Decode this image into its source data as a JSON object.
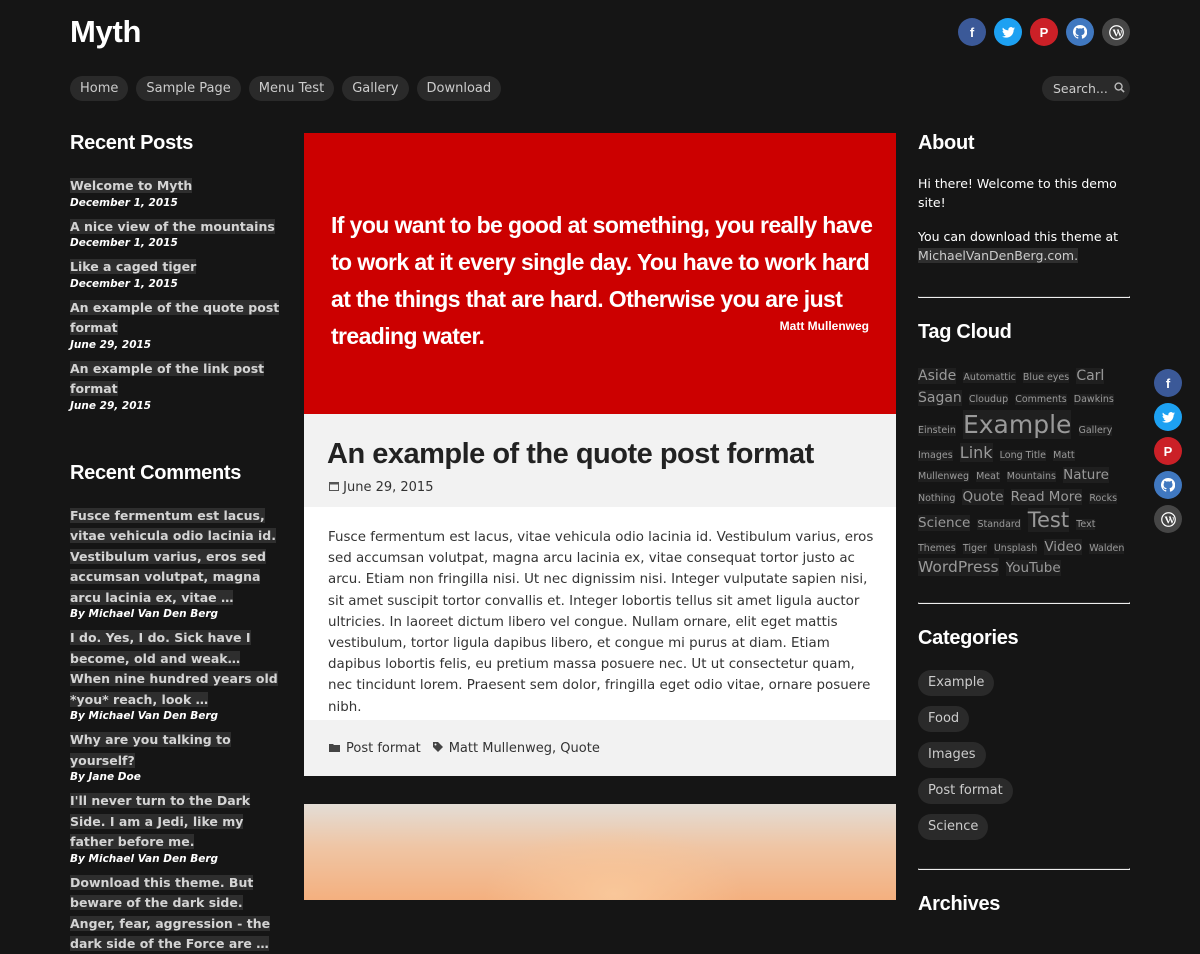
{
  "site": {
    "title": "Myth"
  },
  "social": [
    "facebook-icon",
    "twitter-icon",
    "pinterest-icon",
    "github-icon",
    "wordpress-icon"
  ],
  "nav": {
    "items": [
      "Home",
      "Sample Page",
      "Menu Test",
      "Gallery",
      "Download"
    ]
  },
  "search": {
    "placeholder": "Search..."
  },
  "recent_posts": {
    "title": "Recent Posts",
    "items": [
      {
        "title": "Welcome to Myth",
        "date": "December 1, 2015"
      },
      {
        "title": "A nice view of the mountains",
        "date": "December 1, 2015"
      },
      {
        "title": "Like a caged tiger",
        "date": "December 1, 2015"
      },
      {
        "title": "An example of the quote post format",
        "date": "June 29, 2015"
      },
      {
        "title": "An example of the link post format",
        "date": "June 29, 2015"
      }
    ]
  },
  "recent_comments": {
    "title": "Recent Comments",
    "items": [
      {
        "text": "Fusce fermentum est lacus, vitae vehicula odio lacinia id. Vestibulum varius, eros sed accumsan volutpat, magna arcu lacinia ex, vitae …",
        "by": "By",
        "author": "Michael Van Den Berg"
      },
      {
        "text": "I do. Yes, I do. Sick have I become, old and weak… When nine hundred years old *you* reach, look …",
        "by": "By",
        "author": "Michael Van Den Berg"
      },
      {
        "text": "Why are you talking to yourself?",
        "by": "By",
        "author": "Jane Doe"
      },
      {
        "text": "I'll never turn to the Dark Side. I am a Jedi, like my father before me.",
        "by": "By",
        "author": "Michael Van Den Berg"
      },
      {
        "text": "Download this theme. But beware of the dark side. Anger, fear, aggression - the dark side of the Force are …",
        "by": "",
        "author": ""
      }
    ]
  },
  "quote": {
    "text": "If you want to be good at something, you really have to work at it every single day. You have to work hard at the things that are hard. Otherwise you are just treading water.",
    "author": "Matt Mullenweg"
  },
  "post": {
    "title": "An example of the quote post format",
    "date": "June 29, 2015",
    "body": "Fusce fermentum est lacus, vitae vehicula odio lacinia id. Vestibulum varius, eros sed accumsan volutpat, magna arcu lacinia ex, vitae consequat tortor justo ac arcu. Etiam non fringilla nisi. Ut nec dignissim nisi. Integer vulputate sapien nisi, sit amet suscipit tortor convallis et. Integer lobortis tellus sit amet ligula auctor ultricies. In laoreet dictum libero vel congue. Nullam ornare, elit eget mattis vestibulum, tortor ligula dapibus libero, et congue mi purus at diam. Etiam dapibus lobortis felis, eu pretium massa posuere nec. Ut ut consectetur quam, nec tincidunt lorem. Praesent sem dolor, fringilla eget odio vitae, ornare posuere nibh.",
    "category": "Post format",
    "tags_sep": ", ",
    "tags": [
      "Matt Mullenweg",
      "Quote"
    ]
  },
  "about": {
    "title": "About",
    "line1": "Hi there! Welcome to this demo site!",
    "line2": "You can download this theme at",
    "link": "MichaelVanDenBerg.com."
  },
  "tag_cloud": {
    "title": "Tag Cloud",
    "tags": [
      {
        "name": "Aside",
        "size": 14
      },
      {
        "name": "Automattic",
        "size": 9.5
      },
      {
        "name": "Blue eyes",
        "size": 9.5
      },
      {
        "name": "Carl Sagan",
        "size": 14
      },
      {
        "name": "Cloudup",
        "size": 9.5
      },
      {
        "name": "Comments",
        "size": 9.5
      },
      {
        "name": "Dawkins",
        "size": 9.5
      },
      {
        "name": "Einstein",
        "size": 9.5
      },
      {
        "name": "Example",
        "size": 25
      },
      {
        "name": "Gallery",
        "size": 9.5
      },
      {
        "name": "Images",
        "size": 9.5
      },
      {
        "name": "Link",
        "size": 16
      },
      {
        "name": "Long Title",
        "size": 9.5
      },
      {
        "name": "Matt Mullenweg",
        "size": 9.5
      },
      {
        "name": "Meat",
        "size": 9.5
      },
      {
        "name": "Mountains",
        "size": 9.5
      },
      {
        "name": "Nature",
        "size": 13.5
      },
      {
        "name": "Nothing",
        "size": 9.5
      },
      {
        "name": "Quote",
        "size": 13.5
      },
      {
        "name": "Read More",
        "size": 13.5
      },
      {
        "name": "Rocks",
        "size": 9.5
      },
      {
        "name": "Science",
        "size": 13.5
      },
      {
        "name": "Standard",
        "size": 9.5
      },
      {
        "name": "Test",
        "size": 21
      },
      {
        "name": "Text",
        "size": 9.5
      },
      {
        "name": "Themes",
        "size": 9.5
      },
      {
        "name": "Tiger",
        "size": 9.5
      },
      {
        "name": "Unsplash",
        "size": 9.5
      },
      {
        "name": "Video",
        "size": 13.5
      },
      {
        "name": "Walden",
        "size": 9.5
      },
      {
        "name": "WordPress",
        "size": 15.5
      },
      {
        "name": "YouTube",
        "size": 13.5
      }
    ]
  },
  "categories": {
    "title": "Categories",
    "items": [
      "Example",
      "Food",
      "Images",
      "Post format",
      "Science"
    ]
  },
  "archives": {
    "title": "Archives"
  },
  "colors": {
    "accent_red": "#cc0000",
    "background": "#151515"
  }
}
